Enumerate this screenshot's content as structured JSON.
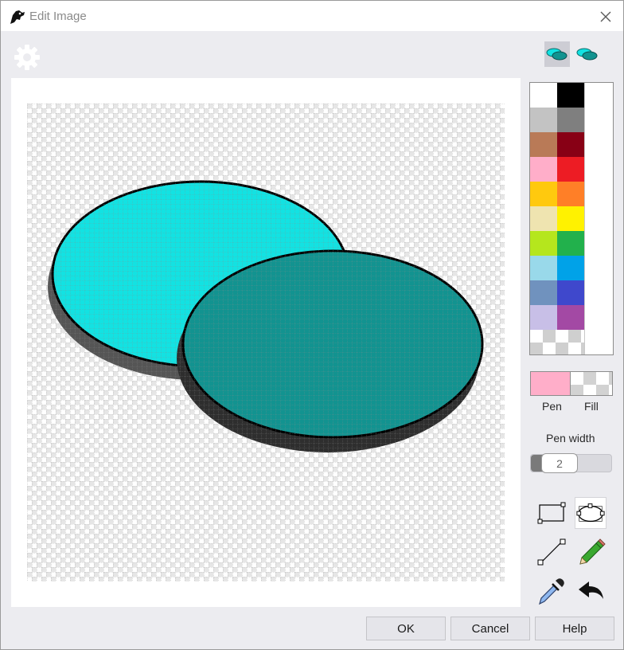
{
  "window": {
    "title": "Edit Image"
  },
  "toolbar": {
    "settings_icon": "gear-icon",
    "mode_single_icon": "ellipse-pair-icon",
    "mode_double_icon": "ellipse-pair-icon"
  },
  "palette": {
    "colors": [
      [
        "#ffffff",
        "#000000",
        ""
      ],
      [
        "#c3c3c3",
        "#7f7f7f",
        ""
      ],
      [
        "#b97a57",
        "#880015",
        ""
      ],
      [
        "#ffaec9",
        "#ed1c24",
        ""
      ],
      [
        "#ffc90e",
        "#ff7f27",
        ""
      ],
      [
        "#efe4b0",
        "#fff200",
        ""
      ],
      [
        "#b5e61d",
        "#22b14c",
        ""
      ],
      [
        "#99d9ea",
        "#00a2e8",
        ""
      ],
      [
        "#7092be",
        "#3f48cc",
        ""
      ],
      [
        "#c8bfe7",
        "#a349a4",
        ""
      ],
      [
        "transparent",
        "",
        ""
      ]
    ]
  },
  "pen": {
    "label": "Pen",
    "color": "#ffaec9"
  },
  "fill": {
    "label": "Fill",
    "color": "transparent"
  },
  "pen_width": {
    "label": "Pen width",
    "value": "2"
  },
  "tools": {
    "rectangle": "rectangle-tool-icon",
    "ellipse": "ellipse-tool-icon",
    "line": "line-tool-icon",
    "pencil": "pencil-icon",
    "eyedropper": "eyedropper-icon",
    "undo": "undo-arrow-icon"
  },
  "canvas": {
    "shapes": [
      {
        "type": "ellipse",
        "fill": "#13e2e2",
        "stroke": "#000000",
        "shadow": "#555555"
      },
      {
        "type": "ellipse",
        "fill": "#129390",
        "stroke": "#000000",
        "shadow": "#2e2e2e"
      }
    ]
  },
  "buttons": {
    "ok": "OK",
    "cancel": "Cancel",
    "help": "Help"
  }
}
